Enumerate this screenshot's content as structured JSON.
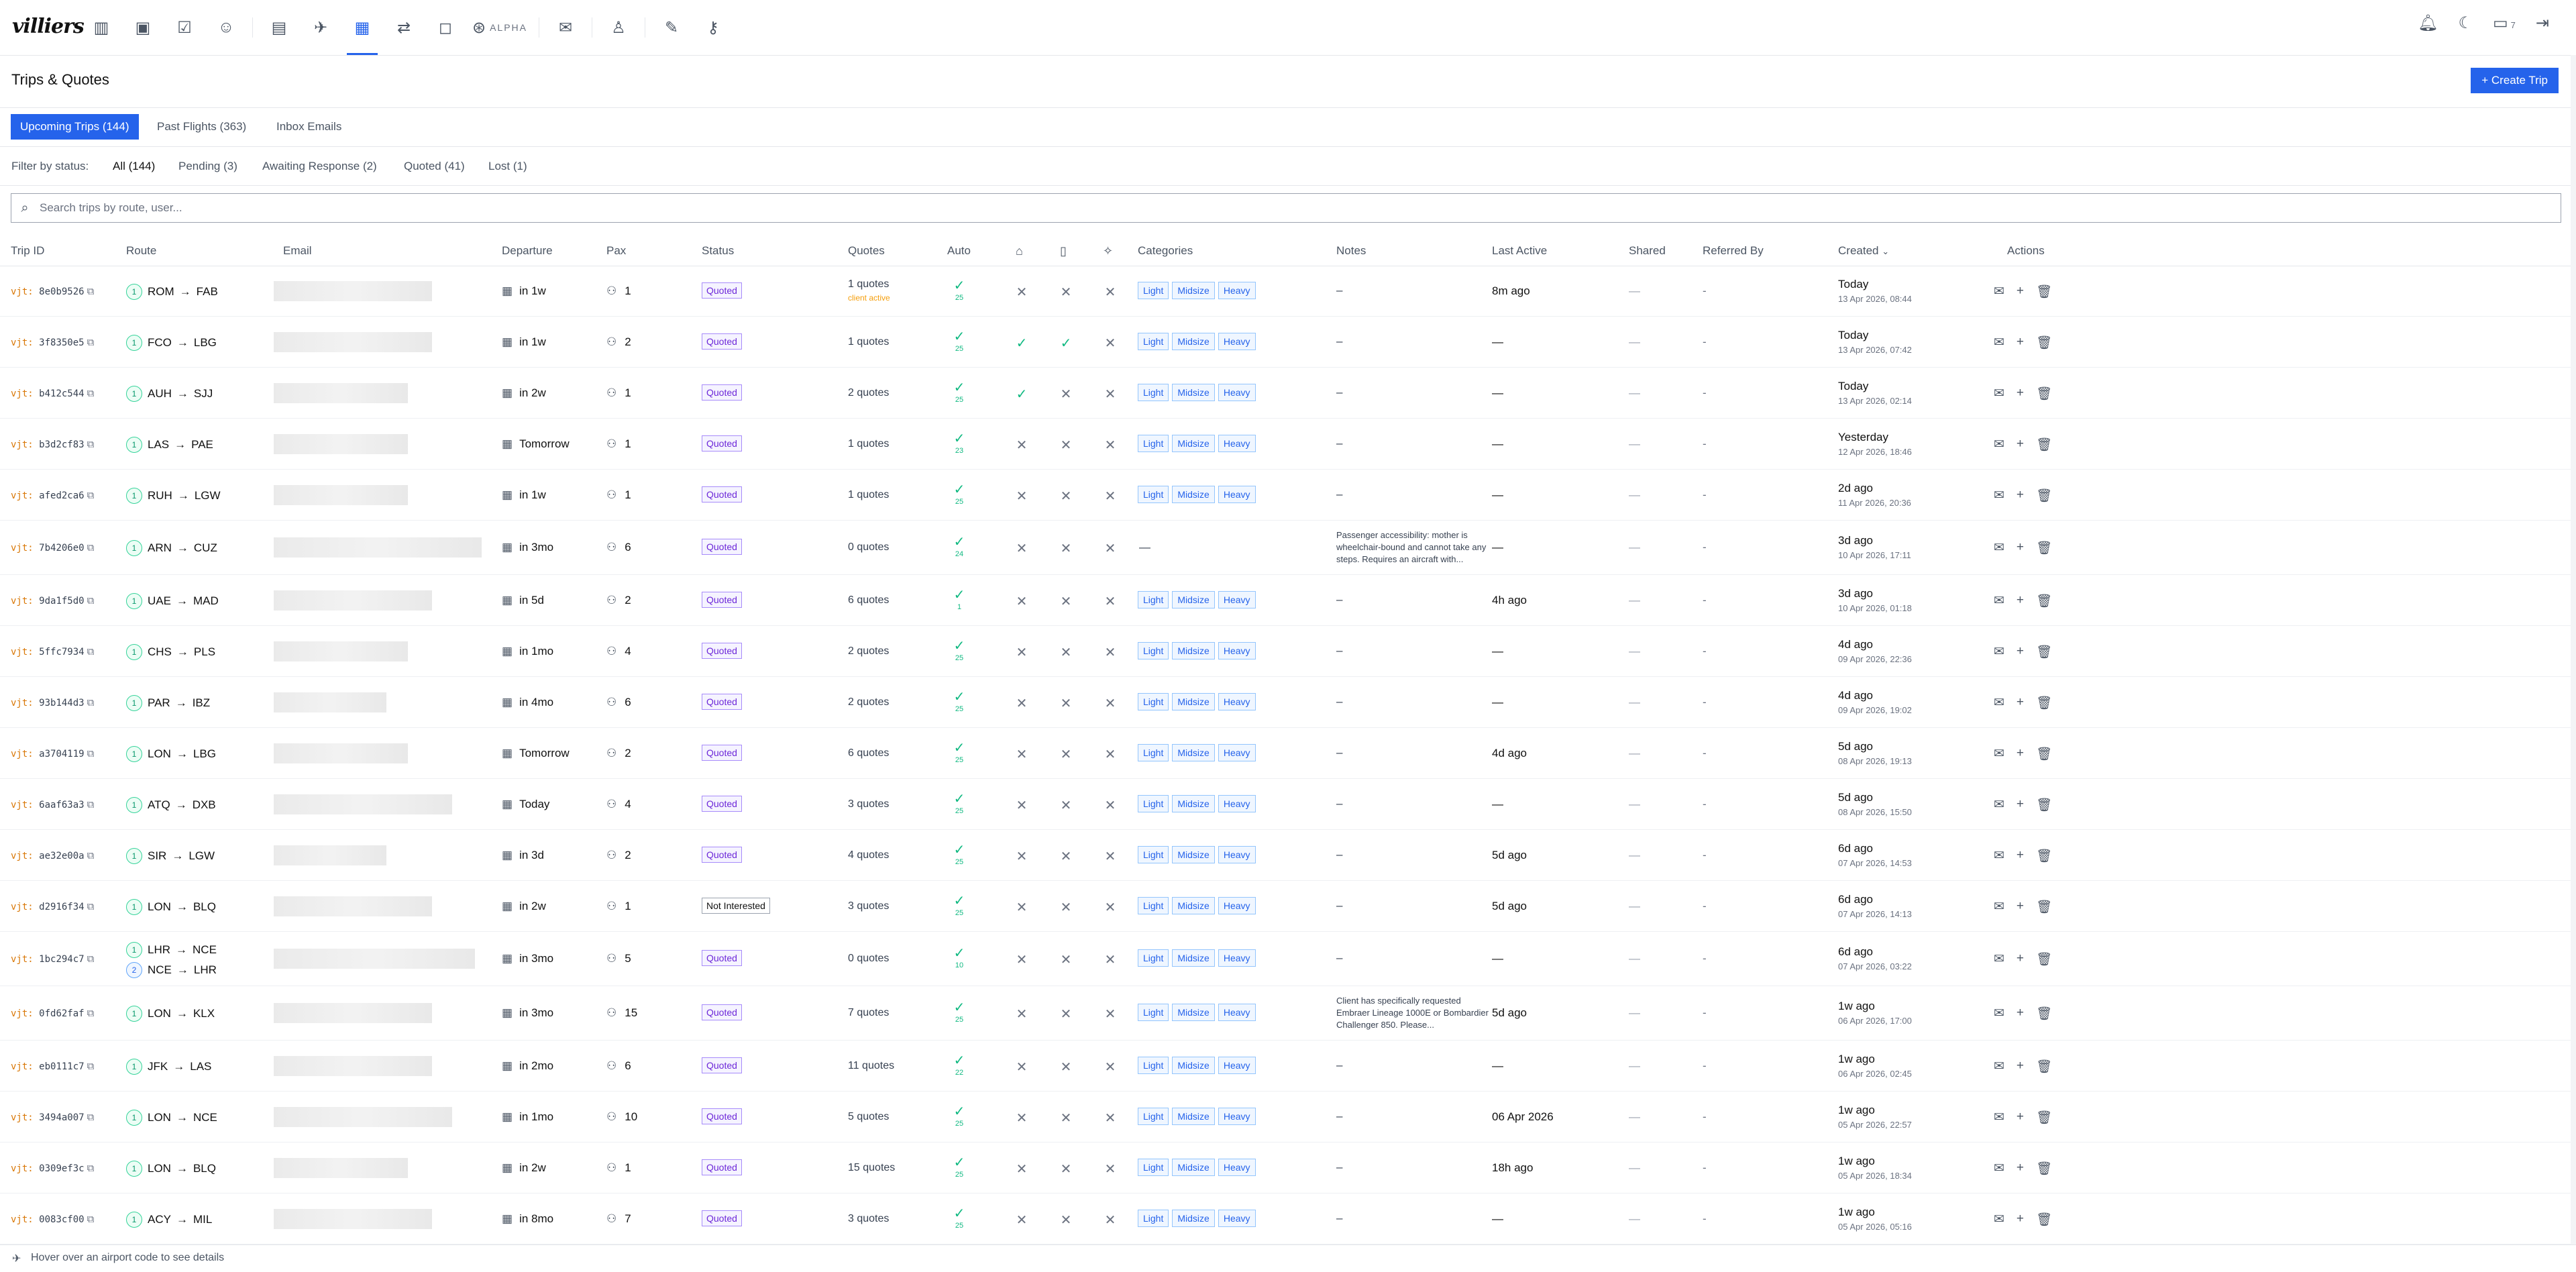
{
  "app": {
    "logo": "villiers",
    "alpha_label": "ALPHA",
    "notification_count": "7"
  },
  "nav_icons": [
    "analytics-icon",
    "wallet-icon",
    "clipboard-icon",
    "users-icon",
    "building-icon",
    "plane-icon",
    "calendar-icon",
    "route-icon",
    "chat-icon",
    "brain-icon",
    "mail-icon",
    "contacts-icon",
    "edit-icon",
    "key-icon"
  ],
  "page": {
    "title": "Trips & Quotes",
    "create_label": "+ Create Trip"
  },
  "tabs": [
    {
      "label": "Upcoming Trips (144)",
      "active": true
    },
    {
      "label": "Past Flights (363)",
      "active": false
    },
    {
      "label": "Inbox Emails",
      "active": false
    }
  ],
  "filter": {
    "label": "Filter by status:",
    "options": [
      "All (144)",
      "Pending (3)",
      "Awaiting Response (2)",
      "Quoted (41)",
      "Lost (1)"
    ]
  },
  "search": {
    "placeholder": "Search trips by route, user..."
  },
  "columns": {
    "trip_id": "Trip ID",
    "route": "Route",
    "email": "Email",
    "departure": "Departure",
    "pax": "Pax",
    "status": "Status",
    "quotes": "Quotes",
    "auto": "Auto",
    "categories": "Categories",
    "notes": "Notes",
    "last_active": "Last Active",
    "shared": "Shared",
    "referred_by": "Referred By",
    "created": "Created",
    "actions": "Actions"
  },
  "category_labels": [
    "Light",
    "Midsize",
    "Heavy"
  ],
  "rows": [
    {
      "id": "8e0b9526",
      "route": [
        [
          "ROM",
          "FAB"
        ]
      ],
      "dep": "in 1w",
      "pax": "1",
      "status": "Quoted",
      "quotes": "1 quotes",
      "quotes_sub": "client active",
      "auto": "25",
      "m": [
        "x",
        "x",
        "x"
      ],
      "cats": true,
      "notes": "–",
      "last": "8m ago",
      "ref": "-",
      "created": "Today",
      "created_sub": "13 Apr 2026, 08:44"
    },
    {
      "id": "3f8350e5",
      "route": [
        [
          "FCO",
          "LBG"
        ]
      ],
      "dep": "in 1w",
      "pax": "2",
      "status": "Quoted",
      "quotes": "1 quotes",
      "auto": "25",
      "m": [
        "ok",
        "ok",
        "x"
      ],
      "cats": true,
      "notes": "–",
      "last": "—",
      "ref": "-",
      "created": "Today",
      "created_sub": "13 Apr 2026, 07:42"
    },
    {
      "id": "b412c544",
      "route": [
        [
          "AUH",
          "SJJ"
        ]
      ],
      "dep": "in 2w",
      "pax": "1",
      "status": "Quoted",
      "quotes": "2 quotes",
      "auto": "25",
      "m": [
        "ok",
        "x",
        "x"
      ],
      "cats": true,
      "notes": "–",
      "last": "—",
      "ref": "-",
      "created": "Today",
      "created_sub": "13 Apr 2026, 02:14"
    },
    {
      "id": "b3d2cf83",
      "route": [
        [
          "LAS",
          "PAE"
        ]
      ],
      "dep": "Tomorrow",
      "pax": "1",
      "status": "Quoted",
      "quotes": "1 quotes",
      "auto": "23",
      "m": [
        "x",
        "x",
        "x"
      ],
      "cats": true,
      "notes": "–",
      "last": "—",
      "ref": "-",
      "created": "Yesterday",
      "created_sub": "12 Apr 2026, 18:46"
    },
    {
      "id": "afed2ca6",
      "route": [
        [
          "RUH",
          "LGW"
        ]
      ],
      "dep": "in 1w",
      "pax": "1",
      "status": "Quoted",
      "quotes": "1 quotes",
      "auto": "25",
      "m": [
        "x",
        "x",
        "x"
      ],
      "cats": true,
      "notes": "–",
      "last": "—",
      "ref": "-",
      "created": "2d ago",
      "created_sub": "11 Apr 2026, 20:36"
    },
    {
      "id": "7b4206e0",
      "route": [
        [
          "ARN",
          "CUZ"
        ]
      ],
      "dep": "in 3mo",
      "pax": "6",
      "status": "Quoted",
      "quotes": "0 quotes",
      "auto": "24",
      "m": [
        "x",
        "x",
        "x"
      ],
      "cats": false,
      "notes": "Passenger accessibility: mother is wheelchair-bound and cannot take any steps. Requires an aircraft with...",
      "last": "—",
      "ref": "-",
      "created": "3d ago",
      "created_sub": "10 Apr 2026, 17:11"
    },
    {
      "id": "9da1f5d0",
      "route": [
        [
          "UAE",
          "MAD"
        ]
      ],
      "dep": "in 5d",
      "pax": "2",
      "status": "Quoted",
      "quotes": "6 quotes",
      "auto": "1",
      "m": [
        "x",
        "x",
        "x"
      ],
      "cats": true,
      "notes": "–",
      "last": "4h ago",
      "ref": "-",
      "created": "3d ago",
      "created_sub": "10 Apr 2026, 01:18"
    },
    {
      "id": "5ffc7934",
      "route": [
        [
          "CHS",
          "PLS"
        ]
      ],
      "dep": "in 1mo",
      "pax": "4",
      "status": "Quoted",
      "quotes": "2 quotes",
      "auto": "25",
      "m": [
        "x",
        "x",
        "x"
      ],
      "cats": true,
      "notes": "–",
      "last": "—",
      "ref": "-",
      "created": "4d ago",
      "created_sub": "09 Apr 2026, 22:36"
    },
    {
      "id": "93b144d3",
      "route": [
        [
          "PAR",
          "IBZ"
        ]
      ],
      "dep": "in 4mo",
      "pax": "6",
      "status": "Quoted",
      "quotes": "2 quotes",
      "auto": "25",
      "m": [
        "x",
        "x",
        "x"
      ],
      "cats": true,
      "notes": "–",
      "last": "—",
      "ref": "-",
      "created": "4d ago",
      "created_sub": "09 Apr 2026, 19:02"
    },
    {
      "id": "a3704119",
      "route": [
        [
          "LON",
          "LBG"
        ]
      ],
      "dep": "Tomorrow",
      "pax": "2",
      "status": "Quoted",
      "quotes": "6 quotes",
      "auto": "25",
      "m": [
        "x",
        "x",
        "x"
      ],
      "cats": true,
      "notes": "–",
      "last": "4d ago",
      "ref": "-",
      "created": "5d ago",
      "created_sub": "08 Apr 2026, 19:13"
    },
    {
      "id": "6aaf63a3",
      "route": [
        [
          "ATQ",
          "DXB"
        ]
      ],
      "dep": "Today",
      "pax": "4",
      "status": "Quoted",
      "quotes": "3 quotes",
      "auto": "25",
      "m": [
        "x",
        "x",
        "x"
      ],
      "cats": true,
      "notes": "–",
      "last": "—",
      "ref": "-",
      "created": "5d ago",
      "created_sub": "08 Apr 2026, 15:50"
    },
    {
      "id": "ae32e00a",
      "route": [
        [
          "SIR",
          "LGW"
        ]
      ],
      "dep": "in 3d",
      "pax": "2",
      "status": "Quoted",
      "quotes": "4 quotes",
      "auto": "25",
      "m": [
        "x",
        "x",
        "x"
      ],
      "cats": true,
      "notes": "–",
      "last": "5d ago",
      "ref": "-",
      "created": "6d ago",
      "created_sub": "07 Apr 2026, 14:53"
    },
    {
      "id": "d2916f34",
      "route": [
        [
          "LON",
          "BLQ"
        ]
      ],
      "dep": "in 2w",
      "pax": "1",
      "status": "Not Interested",
      "quotes": "3 quotes",
      "auto": "25",
      "m": [
        "x",
        "x",
        "x"
      ],
      "cats": true,
      "notes": "–",
      "last": "5d ago",
      "ref": "-",
      "created": "6d ago",
      "created_sub": "07 Apr 2026, 14:13"
    },
    {
      "id": "1bc294c7",
      "route": [
        [
          "LHR",
          "NCE"
        ],
        [
          "NCE",
          "LHR"
        ]
      ],
      "dep": "in 3mo",
      "pax": "5",
      "status": "Quoted",
      "quotes": "0 quotes",
      "auto": "10",
      "m": [
        "x",
        "x",
        "x"
      ],
      "cats": true,
      "notes": "–",
      "last": "—",
      "ref": "-",
      "created": "6d ago",
      "created_sub": "07 Apr 2026, 03:22"
    },
    {
      "id": "0fd62faf",
      "route": [
        [
          "LON",
          "KLX"
        ]
      ],
      "dep": "in 3mo",
      "pax": "15",
      "status": "Quoted",
      "quotes": "7 quotes",
      "auto": "25",
      "m": [
        "x",
        "x",
        "x"
      ],
      "cats": true,
      "notes": "Client has specifically requested Embraer Lineage 1000E or Bombardier Challenger 850. Please...",
      "last": "5d ago",
      "ref": "-",
      "created": "1w ago",
      "created_sub": "06 Apr 2026, 17:00"
    },
    {
      "id": "eb0111c7",
      "route": [
        [
          "JFK",
          "LAS"
        ]
      ],
      "dep": "in 2mo",
      "pax": "6",
      "status": "Quoted",
      "quotes": "11 quotes",
      "auto": "22",
      "m": [
        "x",
        "x",
        "x"
      ],
      "cats": true,
      "notes": "–",
      "last": "—",
      "ref": "-",
      "created": "1w ago",
      "created_sub": "06 Apr 2026, 02:45"
    },
    {
      "id": "3494a007",
      "route": [
        [
          "LON",
          "NCE"
        ]
      ],
      "dep": "in 1mo",
      "pax": "10",
      "status": "Quoted",
      "quotes": "5 quotes",
      "auto": "25",
      "m": [
        "x",
        "x",
        "x"
      ],
      "cats": true,
      "notes": "–",
      "last": "06 Apr 2026",
      "ref": "-",
      "created": "1w ago",
      "created_sub": "05 Apr 2026, 22:57"
    },
    {
      "id": "0309ef3c",
      "route": [
        [
          "LON",
          "BLQ"
        ]
      ],
      "dep": "in 2w",
      "pax": "1",
      "status": "Quoted",
      "quotes": "15 quotes",
      "auto": "25",
      "m": [
        "x",
        "x",
        "x"
      ],
      "cats": true,
      "notes": "–",
      "last": "18h ago",
      "ref": "-",
      "created": "1w ago",
      "created_sub": "05 Apr 2026, 18:34"
    },
    {
      "id": "0083cf00",
      "route": [
        [
          "ACY",
          "MIL"
        ]
      ],
      "dep": "in 8mo",
      "pax": "7",
      "status": "Quoted",
      "quotes": "3 quotes",
      "auto": "25",
      "m": [
        "x",
        "x",
        "x"
      ],
      "cats": true,
      "notes": "–",
      "last": "—",
      "ref": "-",
      "created": "1w ago",
      "created_sub": "05 Apr 2026, 05:16"
    }
  ],
  "footer": {
    "hint": "Hover over an airport code to see details"
  }
}
